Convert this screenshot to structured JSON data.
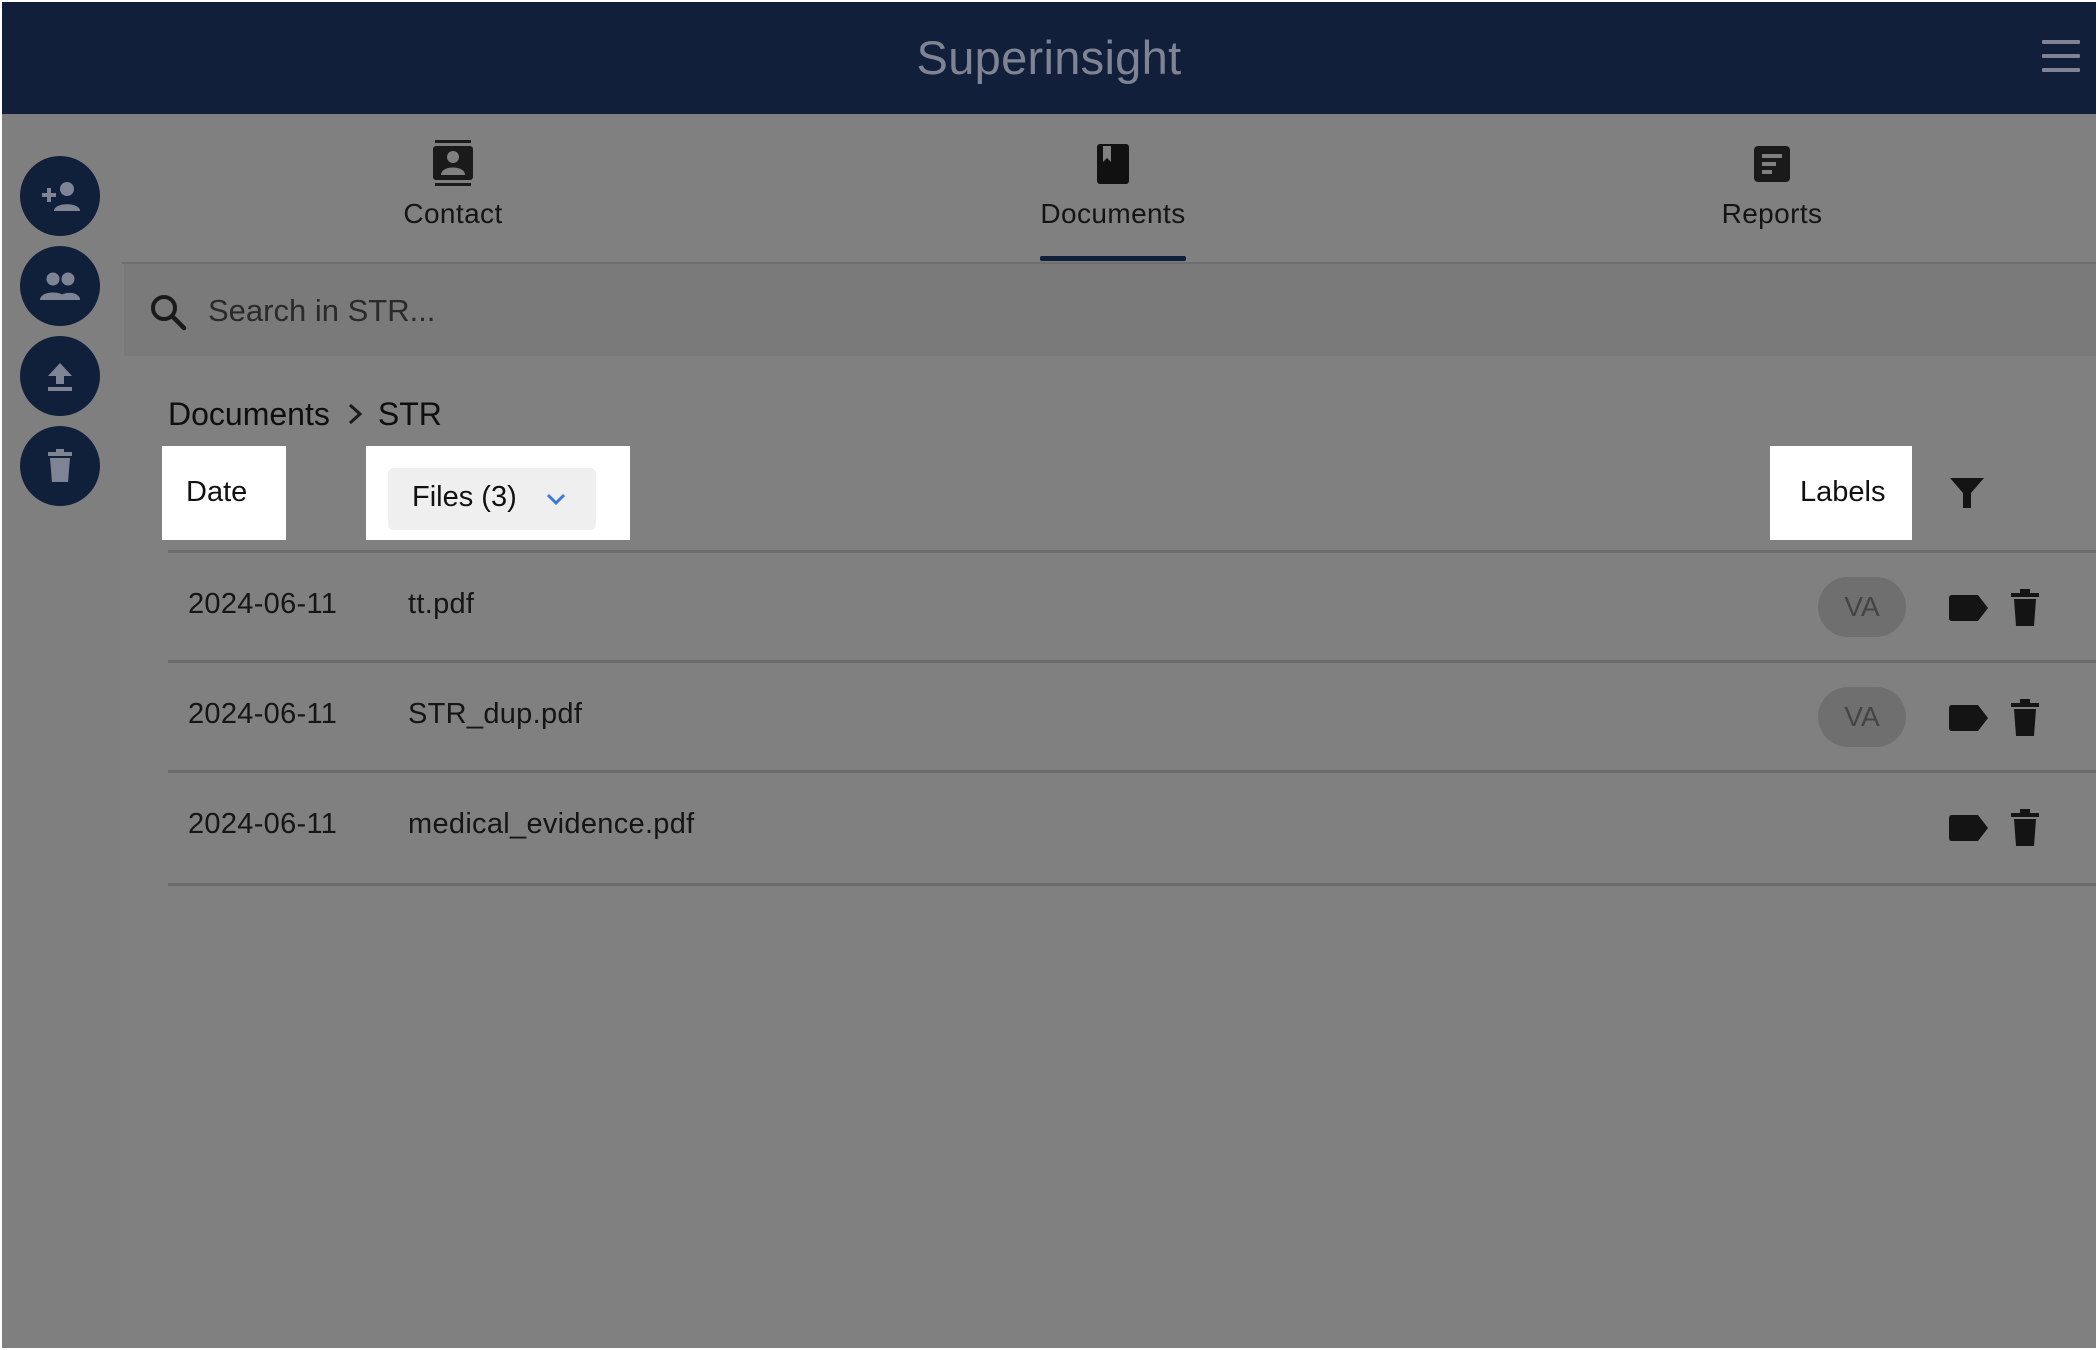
{
  "app": {
    "title": "Superinsight"
  },
  "sidebar": {
    "actions": [
      {
        "name": "add-contact",
        "icon": "person-add-icon"
      },
      {
        "name": "group",
        "icon": "people-icon"
      },
      {
        "name": "upload",
        "icon": "upload-icon"
      },
      {
        "name": "delete",
        "icon": "trash-icon"
      }
    ]
  },
  "tabs": [
    {
      "label": "Contact",
      "icon": "contact-card-icon",
      "active": false
    },
    {
      "label": "Documents",
      "icon": "book-icon",
      "active": true
    },
    {
      "label": "Reports",
      "icon": "report-icon",
      "active": false
    }
  ],
  "search": {
    "placeholder": "Search in STR...",
    "value": ""
  },
  "breadcrumb": {
    "root": "Documents",
    "current": "STR"
  },
  "table": {
    "headers": {
      "date": "Date",
      "files": "Files (3)",
      "labels": "Labels"
    },
    "rows": [
      {
        "date": "2024-06-11",
        "file": "tt.pdf",
        "label": "VA"
      },
      {
        "date": "2024-06-11",
        "file": "STR_dup.pdf",
        "label": "VA"
      },
      {
        "date": "2024-06-11",
        "file": "medical_evidence.pdf",
        "label": ""
      }
    ]
  },
  "colors": {
    "header_bg": "#121f3a",
    "rail_button": "#10203a",
    "accent_chevron": "#3b7bd8",
    "overlay": "#808080"
  }
}
